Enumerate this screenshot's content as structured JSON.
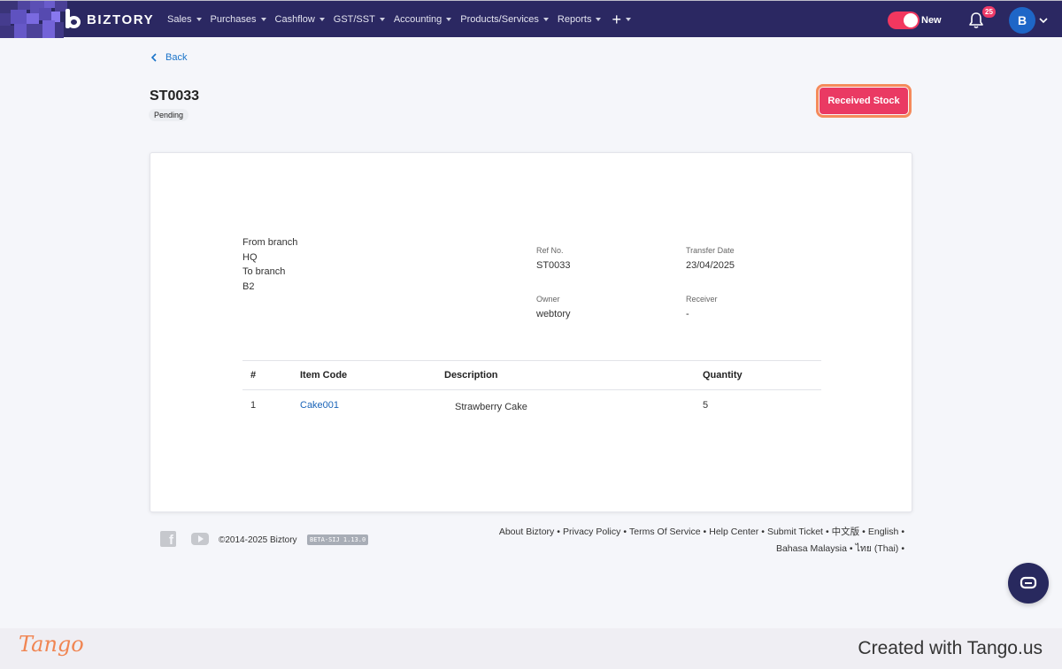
{
  "brand": {
    "name": "BIZTORY"
  },
  "nav": {
    "items": [
      {
        "label": "Sales"
      },
      {
        "label": "Purchases"
      },
      {
        "label": "Cashflow"
      },
      {
        "label": "GST/SST"
      },
      {
        "label": "Accounting"
      },
      {
        "label": "Products/Services"
      },
      {
        "label": "Reports"
      }
    ],
    "plus_label": "+"
  },
  "header_right": {
    "toggle_label": "New",
    "notification_count": "25",
    "avatar_initial": "B"
  },
  "page": {
    "back_label": "Back",
    "title": "ST0033",
    "status": "Pending",
    "action_label": "Received Stock"
  },
  "transfer": {
    "from_label": "From branch",
    "from_value": "HQ",
    "to_label": "To branch",
    "to_value": "B2",
    "ref_label": "Ref No.",
    "ref_value": "ST0033",
    "date_label": "Transfer Date",
    "date_value": "23/04/2025",
    "owner_label": "Owner",
    "owner_value": "webtory",
    "receiver_label": "Receiver",
    "receiver_value": "-"
  },
  "table": {
    "columns": [
      "#",
      "Item Code",
      "Description",
      "Quantity"
    ],
    "rows": [
      {
        "no": "1",
        "code": "Cake001",
        "description": "Strawberry Cake",
        "quantity": "5"
      }
    ]
  },
  "footer": {
    "copyright": "©2014-2025 Biztory",
    "version": "BETA-SIJ 1.13.0",
    "links": [
      "About Biztory",
      "Privacy Policy",
      "Terms Of Service",
      "Help Center",
      "Submit Ticket",
      "中文版",
      "English",
      "Bahasa Malaysia",
      "ไทย (Thai)"
    ]
  },
  "watermark": {
    "logo": "Tango",
    "credit": "Created with Tango.us"
  },
  "colors": {
    "nav_bg": "#2b2862",
    "accent": "#ea3a63",
    "link": "#1a73c9",
    "highlight": "#f58a5b"
  }
}
